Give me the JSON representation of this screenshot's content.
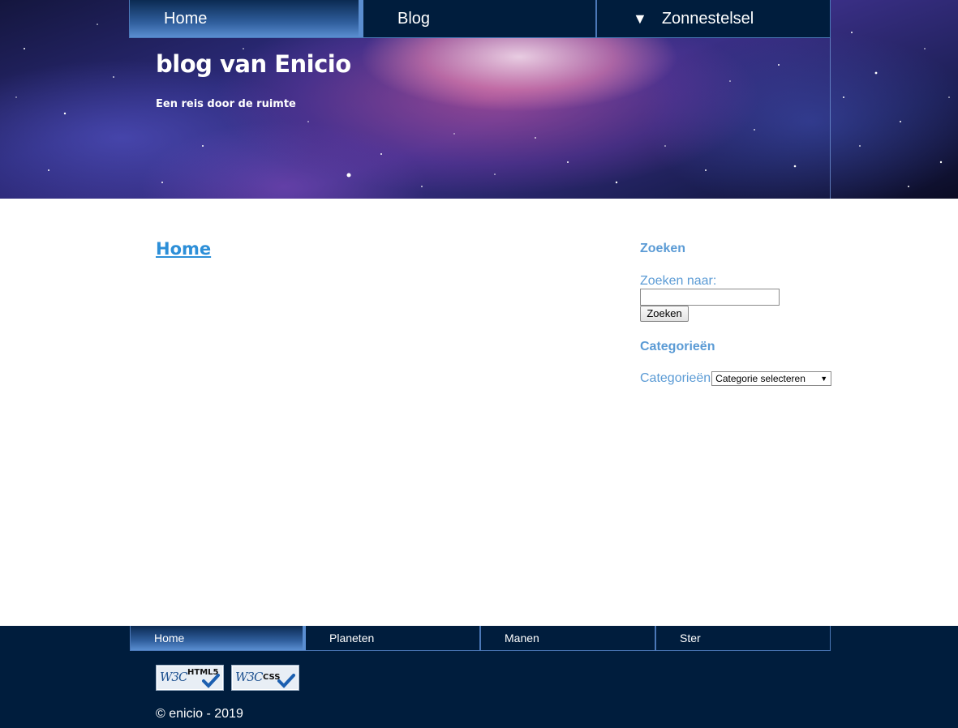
{
  "header": {
    "nav": {
      "home": "Home",
      "blog": "Blog",
      "zonnestelsel": "Zonnestelsel",
      "zonnestelsel_caret": "▼"
    },
    "site_title": "blog van Enicio",
    "tagline": "Een reis door de ruimte"
  },
  "main": {
    "heading": "Home"
  },
  "sidebar": {
    "search_widget_title": "Zoeken",
    "search_label": "Zoeken naar:",
    "search_value": "",
    "search_button": "Zoeken",
    "categories_widget_title": "Categorieën",
    "categories_label": "Categorieën",
    "categories_selected": "Categorie selecteren"
  },
  "footer": {
    "nav": [
      "Home",
      "Planeten",
      "Manen",
      "Ster"
    ],
    "badges": [
      {
        "brand": "W3C",
        "kind": "HTML5"
      },
      {
        "brand": "W3C",
        "kind": "CSS"
      }
    ],
    "copyright": "© enicio - 2019"
  },
  "colors": {
    "nav_bg": "#001d3d",
    "nav_border": "#4b78b8",
    "active_tab": "#5a8ed1",
    "heading_link": "#2d8fd8",
    "sidebar_text": "#5b9bd5"
  }
}
